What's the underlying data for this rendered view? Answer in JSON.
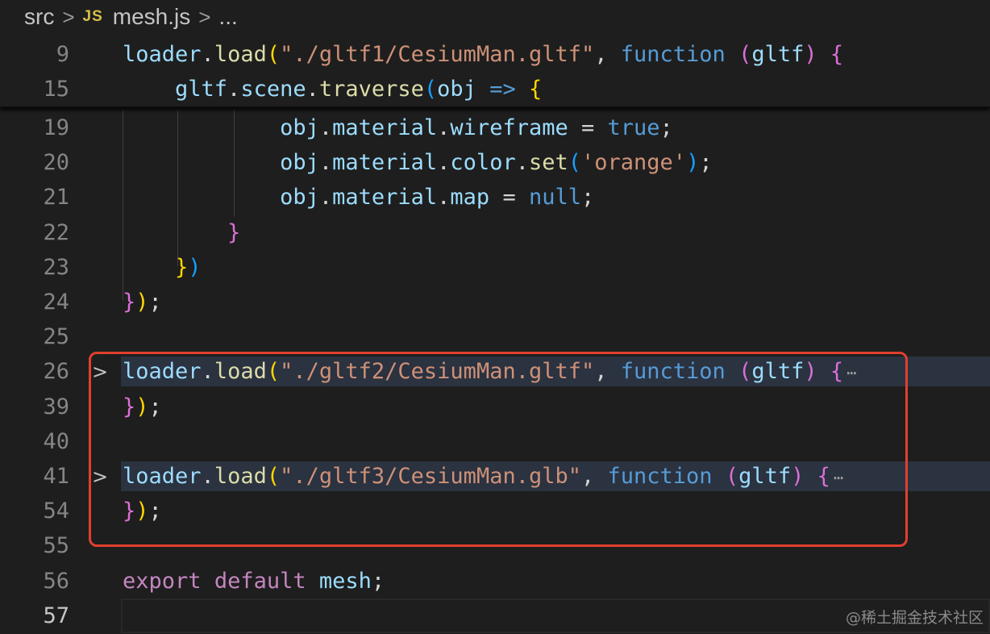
{
  "breadcrumb": {
    "folder": "src",
    "file_icon": "JS",
    "file": "mesh.js",
    "more": "..."
  },
  "sticky_lines": [
    {
      "ln": "9",
      "tokens": [
        {
          "t": "loader",
          "c": "v"
        },
        {
          "t": ".",
          "c": "p"
        },
        {
          "t": "load",
          "c": "fn"
        },
        {
          "t": "(",
          "c": "b1"
        },
        {
          "t": "\"./gltf1/CesiumMan.gltf\"",
          "c": "s"
        },
        {
          "t": ", ",
          "c": "p"
        },
        {
          "t": "function",
          "c": "kw"
        },
        {
          "t": " ",
          "c": "p"
        },
        {
          "t": "(",
          "c": "b2"
        },
        {
          "t": "gltf",
          "c": "v"
        },
        {
          "t": ")",
          "c": "b2"
        },
        {
          "t": " ",
          "c": "p"
        },
        {
          "t": "{",
          "c": "b2"
        }
      ]
    },
    {
      "ln": "15",
      "tokens": [
        {
          "t": "    gltf",
          "c": "v"
        },
        {
          "t": ".",
          "c": "p"
        },
        {
          "t": "scene",
          "c": "v"
        },
        {
          "t": ".",
          "c": "p"
        },
        {
          "t": "traverse",
          "c": "fn"
        },
        {
          "t": "(",
          "c": "b3"
        },
        {
          "t": "obj",
          "c": "v"
        },
        {
          "t": " ",
          "c": "p"
        },
        {
          "t": "=>",
          "c": "kw"
        },
        {
          "t": " ",
          "c": "p"
        },
        {
          "t": "{",
          "c": "b1"
        }
      ]
    }
  ],
  "lines": [
    {
      "ln": "19",
      "tokens": [
        {
          "t": "            obj",
          "c": "v"
        },
        {
          "t": ".",
          "c": "p"
        },
        {
          "t": "material",
          "c": "v"
        },
        {
          "t": ".",
          "c": "p"
        },
        {
          "t": "wireframe",
          "c": "v"
        },
        {
          "t": " = ",
          "c": "p"
        },
        {
          "t": "true",
          "c": "kw"
        },
        {
          "t": ";",
          "c": "p"
        }
      ]
    },
    {
      "ln": "20",
      "tokens": [
        {
          "t": "            obj",
          "c": "v"
        },
        {
          "t": ".",
          "c": "p"
        },
        {
          "t": "material",
          "c": "v"
        },
        {
          "t": ".",
          "c": "p"
        },
        {
          "t": "color",
          "c": "v"
        },
        {
          "t": ".",
          "c": "p"
        },
        {
          "t": "set",
          "c": "fn"
        },
        {
          "t": "(",
          "c": "b3"
        },
        {
          "t": "'orange'",
          "c": "s"
        },
        {
          "t": ")",
          "c": "b3"
        },
        {
          "t": ";",
          "c": "p"
        }
      ]
    },
    {
      "ln": "21",
      "tokens": [
        {
          "t": "            obj",
          "c": "v"
        },
        {
          "t": ".",
          "c": "p"
        },
        {
          "t": "material",
          "c": "v"
        },
        {
          "t": ".",
          "c": "p"
        },
        {
          "t": "map",
          "c": "v"
        },
        {
          "t": " = ",
          "c": "p"
        },
        {
          "t": "null",
          "c": "kw"
        },
        {
          "t": ";",
          "c": "p"
        }
      ]
    },
    {
      "ln": "22",
      "tokens": [
        {
          "t": "        }",
          "c": "b2"
        }
      ]
    },
    {
      "ln": "23",
      "tokens": [
        {
          "t": "    }",
          "c": "b1"
        },
        {
          "t": ")",
          "c": "b3"
        }
      ]
    },
    {
      "ln": "24",
      "tokens": [
        {
          "t": "}",
          "c": "b2"
        },
        {
          "t": ")",
          "c": "b1"
        },
        {
          "t": ";",
          "c": "p"
        }
      ]
    },
    {
      "ln": "25",
      "tokens": []
    },
    {
      "ln": "26",
      "fold": true,
      "tokens": [
        {
          "t": "loader",
          "c": "v"
        },
        {
          "t": ".",
          "c": "p"
        },
        {
          "t": "load",
          "c": "fn"
        },
        {
          "t": "(",
          "c": "b1"
        },
        {
          "t": "\"./gltf2/CesiumMan.gltf\"",
          "c": "s"
        },
        {
          "t": ", ",
          "c": "p"
        },
        {
          "t": "function",
          "c": "kw"
        },
        {
          "t": " ",
          "c": "p"
        },
        {
          "t": "(",
          "c": "b2"
        },
        {
          "t": "gltf",
          "c": "v"
        },
        {
          "t": ")",
          "c": "b2"
        },
        {
          "t": " ",
          "c": "p"
        },
        {
          "t": "{",
          "c": "b2"
        },
        {
          "t": "⋯",
          "c": "ell"
        }
      ]
    },
    {
      "ln": "39",
      "tokens": [
        {
          "t": "}",
          "c": "b2"
        },
        {
          "t": ")",
          "c": "b1"
        },
        {
          "t": ";",
          "c": "p"
        }
      ]
    },
    {
      "ln": "40",
      "tokens": []
    },
    {
      "ln": "41",
      "fold": true,
      "tokens": [
        {
          "t": "loader",
          "c": "v"
        },
        {
          "t": ".",
          "c": "p"
        },
        {
          "t": "load",
          "c": "fn"
        },
        {
          "t": "(",
          "c": "b1"
        },
        {
          "t": "\"./gltf3/CesiumMan.glb\"",
          "c": "s"
        },
        {
          "t": ", ",
          "c": "p"
        },
        {
          "t": "function",
          "c": "kw"
        },
        {
          "t": " ",
          "c": "p"
        },
        {
          "t": "(",
          "c": "b2"
        },
        {
          "t": "gltf",
          "c": "v"
        },
        {
          "t": ")",
          "c": "b2"
        },
        {
          "t": " ",
          "c": "p"
        },
        {
          "t": "{",
          "c": "b2"
        },
        {
          "t": "⋯",
          "c": "ell"
        }
      ]
    },
    {
      "ln": "54",
      "tokens": [
        {
          "t": "}",
          "c": "b2"
        },
        {
          "t": ")",
          "c": "b1"
        },
        {
          "t": ";",
          "c": "p"
        }
      ]
    },
    {
      "ln": "55",
      "tokens": []
    },
    {
      "ln": "56",
      "tokens": [
        {
          "t": "export",
          "c": "kc"
        },
        {
          "t": " ",
          "c": "p"
        },
        {
          "t": "default",
          "c": "kc"
        },
        {
          "t": " ",
          "c": "p"
        },
        {
          "t": "mesh",
          "c": "v"
        },
        {
          "t": ";",
          "c": "p"
        }
      ]
    },
    {
      "ln": "57",
      "current": true,
      "tokens": []
    }
  ],
  "watermark": "@稀土掘金技术社区",
  "colors": {
    "background": "#1e1e1e",
    "highlight_border": "#e0402e",
    "fold_background": "#2b3240"
  }
}
